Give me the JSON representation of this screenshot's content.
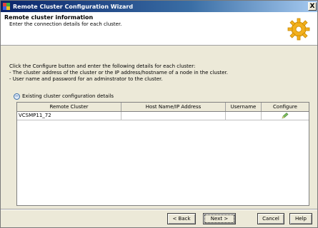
{
  "window": {
    "title": "Remote Cluster Configuration Wizard",
    "close_label": "X"
  },
  "header": {
    "title": "Remote cluster information",
    "subtitle": "Enter the connection details for each cluster."
  },
  "instructions": [
    "Click the Configure button and enter the following details for each cluster:",
    "- The cluster address of the cluster or the IP address/hostname of a node in the cluster.",
    "- User name and password for an adminstrator to the cluster."
  ],
  "section": {
    "label": "Existing cluster configuration details"
  },
  "table": {
    "columns": [
      "Remote Cluster",
      "Host Name/IP Address",
      "Username",
      "Configure"
    ],
    "rows": [
      {
        "remote_cluster": "VCSMP11_72",
        "host": "",
        "username": "",
        "configure_icon": "configure-pencil-icon"
      }
    ]
  },
  "buttons": {
    "back": "< Back",
    "next": "Next >",
    "cancel": "Cancel",
    "help": "Help"
  },
  "colors": {
    "titlebar": "#0a246a",
    "dialog_bg": "#ece9d8",
    "gear": "#f2b01e"
  }
}
